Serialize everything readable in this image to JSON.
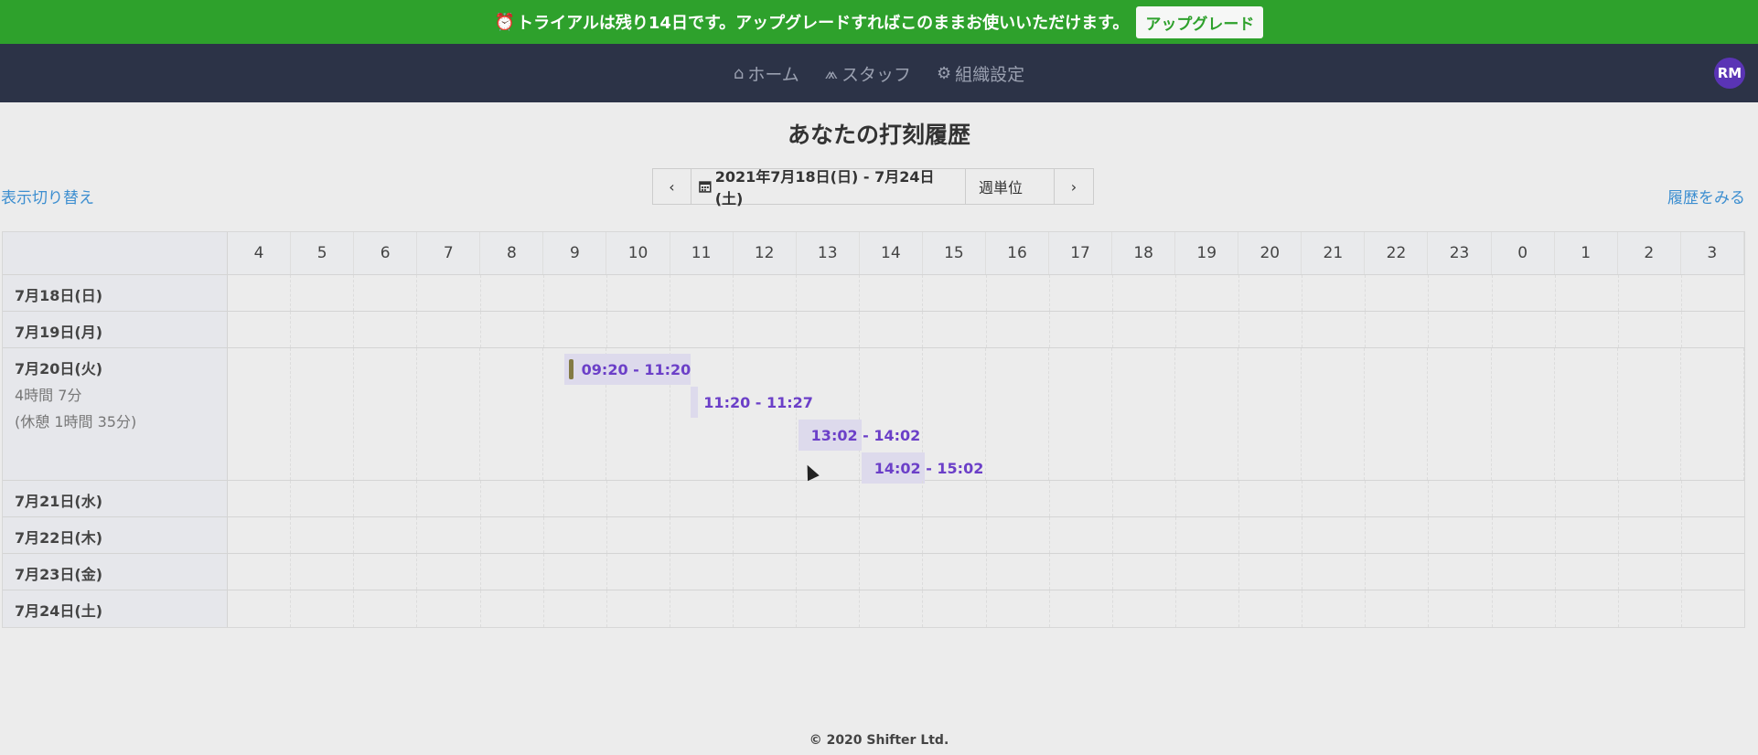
{
  "banner": {
    "clock_icon": "⏰",
    "text": "トライアルは残り14日です。アップグレードすればこのままお使いいただけます。",
    "button": "アップグレード",
    "color": "#2ea12c"
  },
  "nav": {
    "items": [
      {
        "icon": "home-icon",
        "glyph": "⌂",
        "label": "ホーム"
      },
      {
        "icon": "staff-icon",
        "glyph": "⩕",
        "label": "スタッフ"
      },
      {
        "icon": "gear-icon",
        "glyph": "⚙",
        "label": "組織設定"
      }
    ],
    "avatar": "RM"
  },
  "page": {
    "title": "あなたの打刻履歴",
    "toggle_view": "表示切り替え",
    "history_link": "履歴をみる"
  },
  "date_nav": {
    "prev": "‹",
    "calendar_icon": "calendar-icon",
    "range": "2021年7月18日(日) - 7月24日(土)",
    "unit": "週単位",
    "next": "›"
  },
  "grid": {
    "hours": [
      "4",
      "5",
      "6",
      "7",
      "8",
      "9",
      "10",
      "11",
      "12",
      "13",
      "14",
      "15",
      "16",
      "17",
      "18",
      "19",
      "20",
      "21",
      "22",
      "23",
      "0",
      "1",
      "2",
      "3"
    ],
    "days": [
      {
        "label": "7月18日(日)"
      },
      {
        "label": "7月19日(月)"
      },
      {
        "label": "7月20日(火)",
        "total": "4時間 7分",
        "break": "(休憩 1時間 35分)"
      },
      {
        "label": "7月21日(水)"
      },
      {
        "label": "7月22日(木)"
      },
      {
        "label": "7月23日(金)"
      },
      {
        "label": "7月24日(土)"
      }
    ],
    "shifts": [
      {
        "day": "7月20日(火)",
        "start": "09:20",
        "end": "11:20",
        "label": "09:20 - 11:20"
      },
      {
        "day": "7月20日(火)",
        "start": "11:20",
        "end": "11:27",
        "label": "11:20 - 11:27"
      },
      {
        "day": "7月20日(火)",
        "start": "13:02",
        "end": "14:02",
        "label": "13:02 - 14:02"
      },
      {
        "day": "7月20日(火)",
        "start": "14:02",
        "end": "15:02",
        "label": "14:02 - 15:02"
      }
    ]
  },
  "footer": "© 2020 Shifter Ltd."
}
